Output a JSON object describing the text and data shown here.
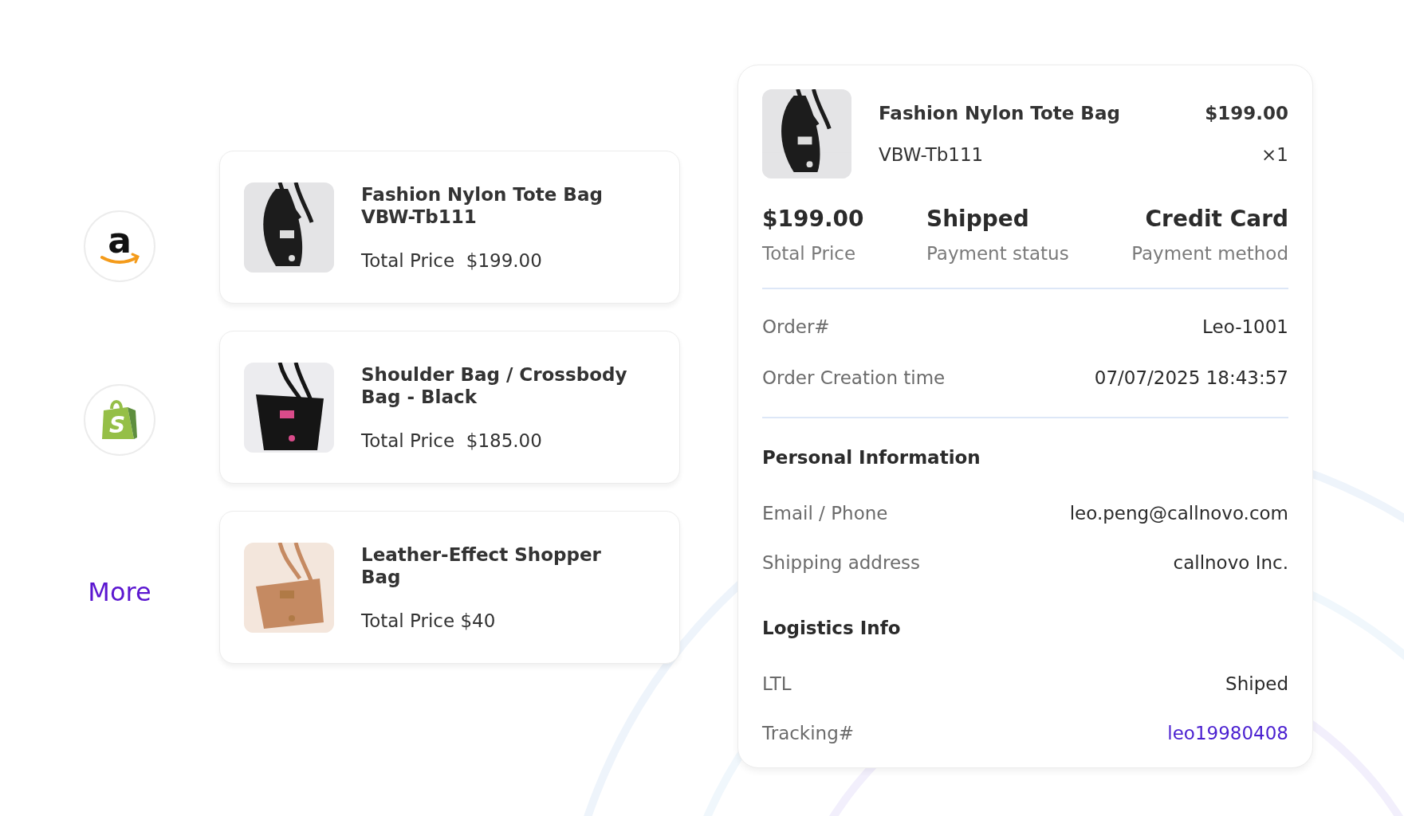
{
  "platforms": [
    {
      "kind": "amazon",
      "letter": "a"
    },
    {
      "kind": "shopify",
      "letter": "S"
    }
  ],
  "more_link": "More",
  "orders": [
    {
      "name": "Fashion Nylon Tote Bag VBW-Tb111",
      "price_label": "Total Price",
      "price": "$199.00"
    },
    {
      "name": "Shoulder Bag / Crossbody Bag - Black",
      "price_label": "Total Price",
      "price": "$185.00"
    },
    {
      "name": "Leather-Effect Shopper Bag",
      "price_label": "Total Price",
      "price": "$40"
    }
  ],
  "detail": {
    "product": {
      "name": "Fashion Nylon Tote Bag",
      "price": "$199.00",
      "sku": "VBW-Tb111",
      "quantity": "×1"
    },
    "stats": [
      {
        "value": "$199.00",
        "label": "Total Price"
      },
      {
        "value": "Shipped",
        "label": "Payment status"
      },
      {
        "value": "Credit Card",
        "label": "Payment method"
      }
    ],
    "order_rows": [
      {
        "label": "Order#",
        "value": "Leo-1001",
        "kind": "text"
      },
      {
        "label": "Order Creation time",
        "value": "07/07/2025 18:43:57",
        "kind": "text"
      }
    ],
    "sections": [
      {
        "title": "Personal Information",
        "rows": [
          {
            "label": "Email / Phone",
            "value": "leo.peng@callnovo.com",
            "kind": "text"
          },
          {
            "label": "Shipping address",
            "value": "callnovo Inc.",
            "kind": "text"
          }
        ]
      },
      {
        "title": "Logistics Info",
        "rows": [
          {
            "label": "LTL",
            "value": "Shiped",
            "kind": "text"
          },
          {
            "label": "Tracking#",
            "value": "leo19980408",
            "kind": "link"
          }
        ]
      }
    ]
  }
}
